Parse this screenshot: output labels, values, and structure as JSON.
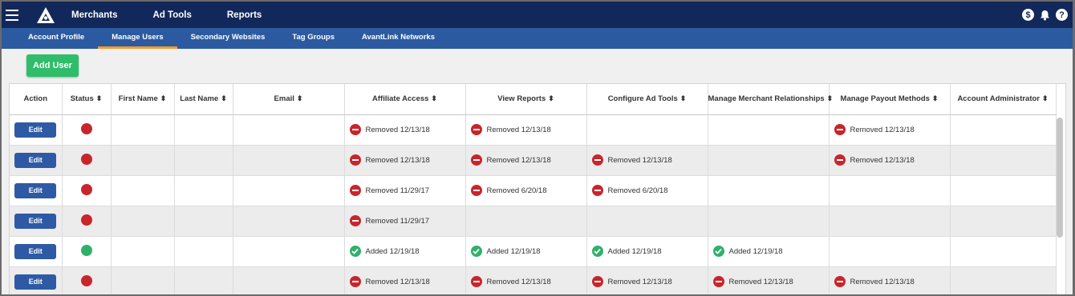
{
  "nav": {
    "items": [
      "Merchants",
      "Ad Tools",
      "Reports"
    ]
  },
  "header_icons": {
    "dollar": "$",
    "bell": "bell-icon",
    "help": "?"
  },
  "subnav": {
    "tabs": [
      "Account Profile",
      "Manage Users",
      "Secondary Websites",
      "Tag Groups",
      "AvantLink Networks"
    ],
    "active_index": 1
  },
  "add_user_label": "Add User",
  "columns": [
    "Action",
    "Status",
    "First Name",
    "Last Name",
    "Email",
    "Affiliate Access",
    "View Reports",
    "Configure Ad Tools",
    "Manage Merchant Relationships",
    "Manage Payout Methods",
    "Account Administrator"
  ],
  "edit_label": "Edit",
  "colors": {
    "status_inactive": "#c8252c",
    "status_active": "#2fb16a",
    "topbar": "#13285a",
    "subbar": "#2c5aa0",
    "add_button": "#2fbd6a",
    "active_tab_underline": "#f29b2c"
  },
  "rows": [
    {
      "status": "inactive",
      "perms": [
        {
          "state": "removed",
          "text": "Removed 12/13/18"
        },
        {
          "state": "removed",
          "text": "Removed 12/13/18"
        },
        null,
        null,
        {
          "state": "removed",
          "text": "Removed 12/13/18"
        },
        null
      ]
    },
    {
      "status": "inactive",
      "perms": [
        {
          "state": "removed",
          "text": "Removed 12/13/18"
        },
        {
          "state": "removed",
          "text": "Removed 12/13/18"
        },
        {
          "state": "removed",
          "text": "Removed 12/13/18"
        },
        null,
        {
          "state": "removed",
          "text": "Removed 12/13/18"
        },
        null
      ]
    },
    {
      "status": "inactive",
      "perms": [
        {
          "state": "removed",
          "text": "Removed 11/29/17"
        },
        {
          "state": "removed",
          "text": "Removed 6/20/18"
        },
        {
          "state": "removed",
          "text": "Removed 6/20/18"
        },
        null,
        null,
        null
      ]
    },
    {
      "status": "inactive",
      "perms": [
        {
          "state": "removed",
          "text": "Removed 11/29/17"
        },
        null,
        null,
        null,
        null,
        null
      ]
    },
    {
      "status": "active",
      "perms": [
        {
          "state": "added",
          "text": "Added 12/19/18"
        },
        {
          "state": "added",
          "text": "Added 12/19/18"
        },
        {
          "state": "added",
          "text": "Added 12/19/18"
        },
        {
          "state": "added",
          "text": "Added 12/19/18"
        },
        null,
        null
      ]
    },
    {
      "status": "inactive",
      "perms": [
        {
          "state": "removed",
          "text": "Removed 12/13/18"
        },
        {
          "state": "removed",
          "text": "Removed 12/13/18"
        },
        {
          "state": "removed",
          "text": "Removed 12/13/18"
        },
        {
          "state": "removed",
          "text": "Removed 12/13/18"
        },
        {
          "state": "removed",
          "text": "Removed 12/13/18"
        },
        null
      ]
    }
  ]
}
